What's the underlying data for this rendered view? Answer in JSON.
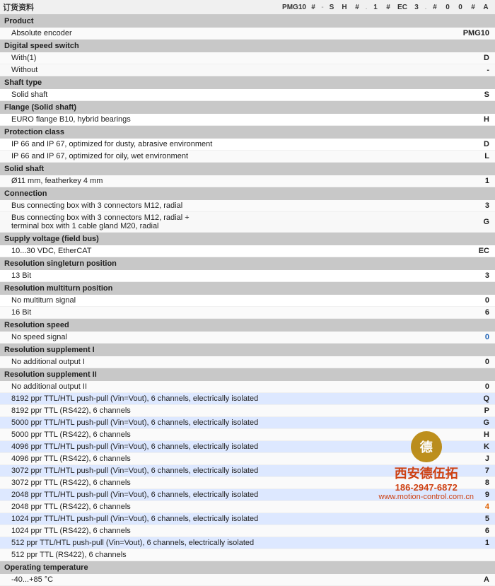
{
  "header": {
    "title": "订货资料",
    "product_code": "PMG10",
    "code_parts": [
      "PMG10",
      "#",
      "-",
      "S",
      "H",
      "#",
      ".",
      "1",
      "#",
      "EC",
      "3",
      ".",
      "#",
      "0",
      "0",
      "#",
      "A"
    ]
  },
  "sections": [
    {
      "id": "product",
      "label": "Product",
      "rows": [
        {
          "text": "Absolute encoder",
          "value": "PMG10",
          "codes": [],
          "indent": true
        }
      ]
    },
    {
      "id": "digital_speed_switch",
      "label": "Digital speed switch",
      "rows": [
        {
          "text": "With(1)",
          "value": "D",
          "codes": [],
          "indent": true
        },
        {
          "text": "Without",
          "value": "-",
          "codes": [],
          "indent": true
        }
      ]
    },
    {
      "id": "shaft_type",
      "label": "Shaft type",
      "rows": [
        {
          "text": "Solid shaft",
          "value": "S",
          "codes": [],
          "indent": true
        }
      ]
    },
    {
      "id": "flange",
      "label": "Flange (Solid shaft)",
      "rows": [
        {
          "text": "EURO flange B10, hybrid bearings",
          "value": "H",
          "codes": [],
          "indent": true
        }
      ]
    },
    {
      "id": "protection_class",
      "label": "Protection class",
      "rows": [
        {
          "text": "IP 66 and IP 67, optimized for dusty, abrasive environment",
          "value": "D",
          "codes": [],
          "indent": true
        },
        {
          "text": "IP 66 and IP 67, optimized for oily, wet environment",
          "value": "L",
          "codes": [],
          "indent": true
        }
      ]
    },
    {
      "id": "solid_shaft",
      "label": "Solid shaft",
      "rows": [
        {
          "text": "Ø11 mm, featherkey 4 mm",
          "value": "1",
          "codes": [],
          "indent": true
        }
      ]
    },
    {
      "id": "connection",
      "label": "Connection",
      "rows": [
        {
          "text": "Bus connecting box with 3 connectors M12, radial",
          "value": "3",
          "codes": [],
          "indent": true
        },
        {
          "text": "Bus connecting box with 3 connectors M12, radial +\nterminal box with 1 cable gland M20, radial",
          "value": "G",
          "codes": [],
          "indent": true,
          "multiline": true
        }
      ]
    },
    {
      "id": "supply_voltage",
      "label": "Supply voltage (field bus)",
      "rows": [
        {
          "text": "10...30 VDC, EtherCAT",
          "value": "EC",
          "codes": [],
          "indent": true
        }
      ]
    },
    {
      "id": "resolution_singleturn",
      "label": "Resolution singleturn position",
      "rows": [
        {
          "text": "13 Bit",
          "value": "3",
          "codes": [],
          "indent": true
        }
      ]
    },
    {
      "id": "resolution_multiturn",
      "label": "Resolution multiturn position",
      "rows": [
        {
          "text": "No multiturn signal",
          "value": "0",
          "codes": [],
          "indent": true
        },
        {
          "text": "16 Bit",
          "value": "6",
          "codes": [],
          "indent": true
        }
      ]
    },
    {
      "id": "resolution_speed",
      "label": "Resolution speed",
      "rows": [
        {
          "text": "No speed signal",
          "value": "0",
          "codes": [],
          "indent": true,
          "value_color": "blue"
        }
      ]
    },
    {
      "id": "resolution_supplement_I",
      "label": "Resolution supplement I",
      "rows": [
        {
          "text": "No additional output I",
          "value": "0",
          "codes": [],
          "indent": true
        }
      ]
    },
    {
      "id": "resolution_supplement_II",
      "label": "Resolution supplement II",
      "rows": [
        {
          "text": "No additional output II",
          "value": "0",
          "codes": [],
          "indent": true
        },
        {
          "text": "8192 ppr TTL/HTL push-pull (Vin=Vout), 6 channels, electrically isolated",
          "value": "Q",
          "codes": [],
          "indent": true,
          "highlight": true
        },
        {
          "text": "8192 ppr TTL (RS422), 6 channels",
          "value": "P",
          "codes": [],
          "indent": true,
          "highlight": true
        },
        {
          "text": "5000 ppr TTL/HTL push-pull (Vin=Vout), 6 channels, electrically isolated",
          "value": "G",
          "codes": [],
          "indent": true,
          "highlight": true
        },
        {
          "text": "5000 ppr TTL (RS422), 6 channels",
          "value": "H",
          "codes": [],
          "indent": true,
          "highlight": true
        },
        {
          "text": "4096 ppr TTL/HTL push-pull (Vin=Vout), 6 channels, electrically isolated",
          "value": "K",
          "codes": [],
          "indent": true,
          "highlight": true
        },
        {
          "text": "4096 ppr TTL (RS422), 6 channels",
          "value": "J",
          "codes": [],
          "indent": true,
          "highlight": true
        },
        {
          "text": "3072 ppr TTL/HTL push-pull (Vin=Vout), 6 channels, electrically isolated",
          "value": "7",
          "codes": [],
          "indent": true,
          "highlight": true
        },
        {
          "text": "3072 ppr TTL (RS422), 6 channels",
          "value": "8",
          "codes": [],
          "indent": true,
          "highlight": true
        },
        {
          "text": "2048 ppr TTL/HTL push-pull (Vin=Vout), 6 channels, electrically isolated",
          "value": "9",
          "codes": [],
          "indent": true,
          "highlight": true
        },
        {
          "text": "2048 ppr TTL (RS422), 6 channels",
          "value": "4",
          "codes": [],
          "indent": true,
          "value_color": "orange",
          "highlight": true
        },
        {
          "text": "1024 ppr TTL/HTL push-pull (Vin=Vout), 6 channels, electrically isolated",
          "value": "5",
          "codes": [],
          "indent": true,
          "highlight": true
        },
        {
          "text": "1024 ppr TTL (RS422), 6 channels",
          "value": "6",
          "codes": [],
          "indent": true,
          "highlight": true
        },
        {
          "text": "512 ppr TTL/HTL push-pull (Vin=Vout), 6 channels, electrically isolated",
          "value": "1",
          "codes": [],
          "indent": true,
          "highlight": true
        },
        {
          "text": "512 ppr TTL (RS422), 6 channels",
          "value": "",
          "codes": [],
          "indent": true,
          "highlight": true
        }
      ]
    },
    {
      "id": "operating_temperature",
      "label": "Operating temperature",
      "rows": [
        {
          "text": "-40...+85 °C",
          "value": "A",
          "codes": [],
          "indent": true
        }
      ]
    }
  ],
  "watermark": {
    "logo_char": "德",
    "line1": "西安德伍拓",
    "line2": "186-2947-6872",
    "line3": "www.motion-control.com.cn"
  }
}
